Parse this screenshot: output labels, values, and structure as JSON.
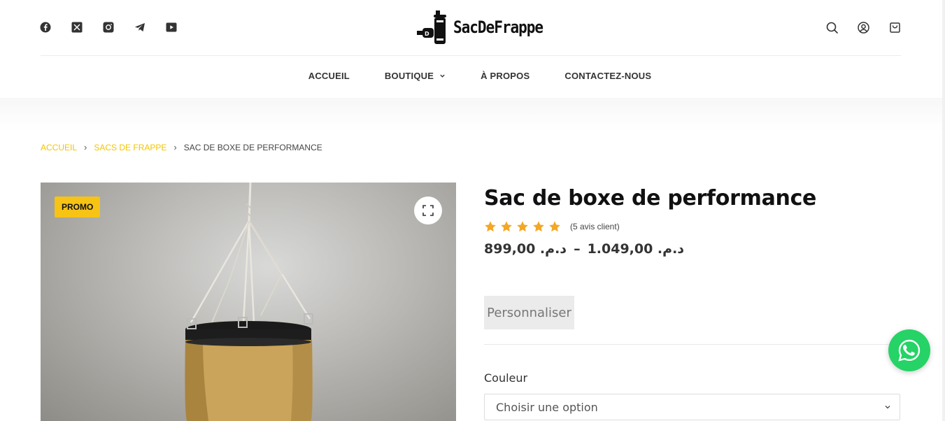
{
  "header": {
    "social": [
      {
        "icon": "facebook-icon"
      },
      {
        "icon": "x-twitter-icon"
      },
      {
        "icon": "instagram-icon"
      },
      {
        "icon": "telegram-icon"
      },
      {
        "icon": "youtube-icon"
      }
    ],
    "logo_text": "SacDeFrappe",
    "actions": [
      "search-icon",
      "account-icon",
      "cart-icon"
    ]
  },
  "nav": {
    "items": [
      "ACCUEIL",
      "BOUTIQUE",
      "À PROPOS",
      "CONTACTEZ-NOUS"
    ]
  },
  "breadcrumb": {
    "home": "ACCUEIL",
    "category": "SACS DE FRAPPE",
    "current": "SAC DE BOXE DE PERFORMANCE"
  },
  "gallery": {
    "badge": "PROMO"
  },
  "product": {
    "title": "Sac de boxe de performance",
    "rating": 5,
    "reviews": "(5 avis client)",
    "price_low": "899,00 .د.م",
    "price_sep": "–",
    "price_high": "1.049,00 .د.م",
    "customize_label": "Personnaliser",
    "color_label": "Couleur",
    "color_placeholder": "Choisir une option"
  },
  "colors": {
    "accent": "#f3c500",
    "star": "#f5a623",
    "whatsapp": "#25d366"
  }
}
